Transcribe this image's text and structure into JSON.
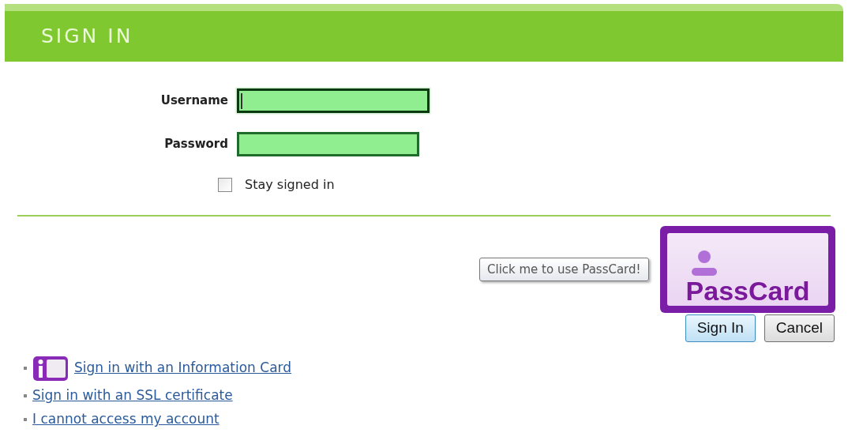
{
  "header": {
    "title": "SIGN IN"
  },
  "fields": [
    {
      "label": "Username",
      "focused": true
    },
    {
      "label": "Password",
      "focused": false
    }
  ],
  "stay_signed_in": {
    "label": "Stay signed in",
    "checked": false
  },
  "passcard": {
    "logo_text": "PassCard",
    "tooltip": "Click me to use PassCard!"
  },
  "buttons": [
    {
      "label": "Sign In",
      "kind": "primary"
    },
    {
      "label": "Cancel",
      "kind": "secondary"
    }
  ],
  "links": [
    {
      "label": "Sign in with an Information Card",
      "kind": "infocard"
    },
    {
      "label": "Sign in with an SSL certificate",
      "kind": "plain"
    },
    {
      "label": "I cannot access my account",
      "kind": "plain"
    }
  ]
}
